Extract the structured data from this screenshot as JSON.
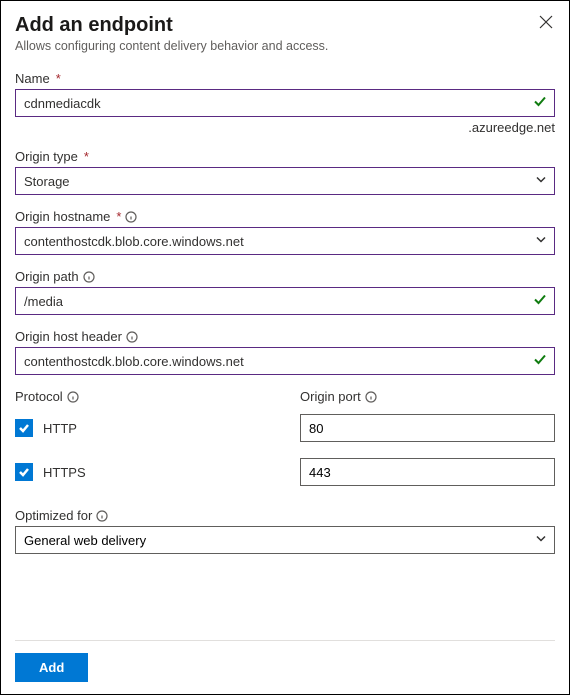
{
  "header": {
    "title": "Add an endpoint",
    "subtitle": "Allows configuring content delivery behavior and access."
  },
  "fields": {
    "name": {
      "label": "Name",
      "value": "cdnmediacdk",
      "suffix": ".azureedge.net"
    },
    "origin_type": {
      "label": "Origin type",
      "value": "Storage"
    },
    "origin_hostname": {
      "label": "Origin hostname",
      "value": "contenthostcdk.blob.core.windows.net"
    },
    "origin_path": {
      "label": "Origin path",
      "value": "/media"
    },
    "origin_host_header": {
      "label": "Origin host header",
      "value": "contenthostcdk.blob.core.windows.net"
    },
    "protocol": {
      "label": "Protocol"
    },
    "http": {
      "label": "HTTP"
    },
    "https": {
      "label": "HTTPS"
    },
    "origin_port": {
      "label": "Origin port"
    },
    "port_http": {
      "value": "80"
    },
    "port_https": {
      "value": "443"
    },
    "optimized": {
      "label": "Optimized for",
      "value": "General web delivery"
    }
  },
  "footer": {
    "add": "Add"
  }
}
